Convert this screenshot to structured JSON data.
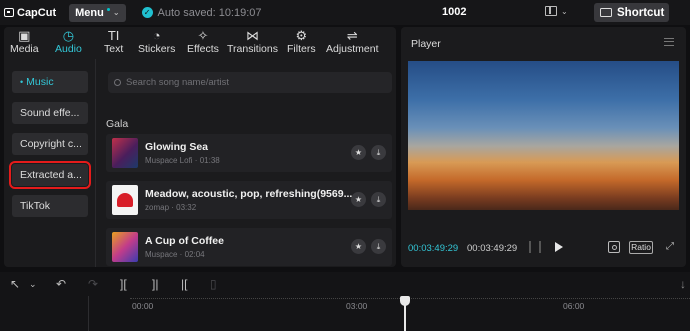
{
  "app": {
    "logo_text": "CapCut",
    "menu_label": "Menu",
    "autosave_text": "Auto saved: 10:19:07",
    "project_title": "1002",
    "shortcut_label": "Shortcut"
  },
  "tabs": [
    {
      "label": "Media",
      "icon": "media-icon"
    },
    {
      "label": "Audio",
      "icon": "audio-icon"
    },
    {
      "label": "Text",
      "icon": "text-icon"
    },
    {
      "label": "Stickers",
      "icon": "sticker-icon"
    },
    {
      "label": "Effects",
      "icon": "effects-icon"
    },
    {
      "label": "Transitions",
      "icon": "transitions-icon"
    },
    {
      "label": "Filters",
      "icon": "filters-icon"
    },
    {
      "label": "Adjustment",
      "icon": "adjustment-icon"
    }
  ],
  "active_tab": "Audio",
  "sidebar": {
    "items": [
      {
        "label": "Music"
      },
      {
        "label": "Sound effe..."
      },
      {
        "label": "Copyright c..."
      },
      {
        "label": "Extracted a..."
      },
      {
        "label": "TikTok"
      }
    ],
    "active_item": "Music",
    "highlighted_item": "Extracted a..."
  },
  "search": {
    "placeholder": "Search song name/artist"
  },
  "group_title": "Gala",
  "songs": [
    {
      "title": "Glowing Sea",
      "meta": "Muspace Lofi · 01:38"
    },
    {
      "title": "Meadow, acoustic, pop, refreshing(9569...",
      "meta": "zomap · 03:32"
    },
    {
      "title": "A Cup of Coffee",
      "meta": "Muspace · 02:04"
    }
  ],
  "player": {
    "title": "Player",
    "time_current": "00:03:49:29",
    "time_total": "00:03:49:29",
    "ratio_label": "Ratio"
  },
  "timeline": {
    "ticks": [
      "00:00",
      "03:00",
      "06:00"
    ]
  },
  "colors": {
    "accent": "#33c6d6",
    "highlight": "#e51b1b"
  }
}
